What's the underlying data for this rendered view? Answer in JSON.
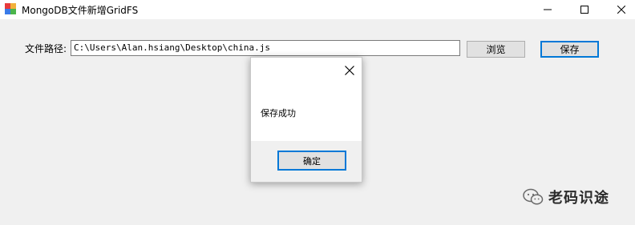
{
  "window": {
    "title": "MongoDB文件新增GridFS"
  },
  "form": {
    "path_label": "文件路径:",
    "path_value": "C:\\Users\\Alan.hsiang\\Desktop\\china.js",
    "browse_label": "浏览",
    "save_label": "保存"
  },
  "dialog": {
    "message": "保存成功",
    "ok_label": "确定"
  },
  "watermark": {
    "text": "老码识途"
  },
  "colors": {
    "accent": "#0078d7",
    "background": "#f0f0f0"
  }
}
